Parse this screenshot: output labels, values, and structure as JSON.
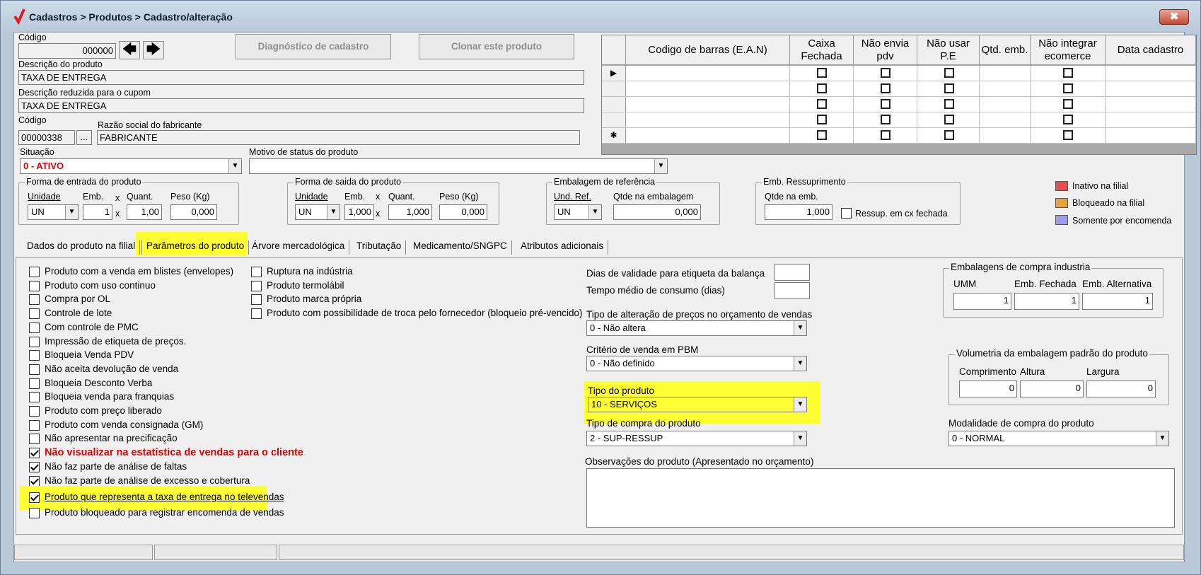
{
  "window": {
    "title": "Cadastros > Produtos > Cadastro/alteração",
    "close_label": "✖"
  },
  "header": {
    "codigo_label": "Código",
    "codigo_value": "000000",
    "diag_btn": "Diagnóstico de cadastro",
    "clonar_btn": "Clonar este produto",
    "descricao_label": "Descrição  do produto",
    "descricao_value": "TAXA DE ENTREGA",
    "desc_red_label": "Descrição reduzida para o cupom",
    "desc_red_value": "TAXA DE ENTREGA",
    "fab_codigo_label": "Código",
    "fab_codigo_value": "00000338",
    "fab_btn": "...",
    "razao_label": "Razão social do fabricante",
    "razao_value": "FABRICANTE",
    "situacao_label": "Situação",
    "situacao_value": "0 - ATIVO",
    "motivo_label": "Motivo de status do produto",
    "motivo_value": ""
  },
  "barcode_grid": {
    "columns": [
      "Codigo de barras (E.A.N)",
      "Caixa Fechada",
      "Não envia pdv",
      "Não usar P.E",
      "Qtd. emb.",
      "Não integrar ecomerce",
      "Data cadastro"
    ],
    "rows": [
      {
        "indicator": "▶"
      },
      {
        "indicator": ""
      },
      {
        "indicator": ""
      },
      {
        "indicator": ""
      },
      {
        "indicator": "✱"
      }
    ]
  },
  "entrada": {
    "title": "Forma de entrada do produto",
    "unidade_label": "Unidade",
    "emb_label": "Emb.",
    "quant_label": "Quant.",
    "peso_label": "Peso (Kg)",
    "unidade": "UN",
    "emb": "1",
    "quant": "1,00",
    "peso": "0,000",
    "x": "x"
  },
  "saida": {
    "title": "Forma de saida do produto",
    "unidade_label": "Unidade",
    "emb_label": "Emb.",
    "quant_label": "Quant.",
    "peso_label": "Peso (Kg)",
    "unidade": "UN",
    "emb": "1,000",
    "quant": "1,000",
    "peso": "0,000",
    "x": "x"
  },
  "embref": {
    "title": "Embalagem de referência",
    "und_label": "Und. Ref.",
    "qtde_label": "Qtde na embalagem",
    "und": "UN",
    "qtde": "0,000"
  },
  "ressup": {
    "title": "Emb. Ressuprimento",
    "qtde_label": "Qtde na emb.",
    "qtde": "1,000",
    "cx_label": "Ressup. em cx fechada"
  },
  "legend": [
    {
      "label": "Inativo na filial",
      "color": "#e05050"
    },
    {
      "label": "Bloqueado na filial",
      "color": "#e8a040"
    },
    {
      "label": "Somente por encomenda",
      "color": "#9c9ce8"
    }
  ],
  "tabs": [
    "Dados do produto na filial",
    "Parâmetros do produto",
    "Árvore mercadológica",
    "Tributação",
    "Medicamento/SNGPC",
    "Atributos adicionais"
  ],
  "checks_left": [
    {
      "label": "Produto com a venda em blistes (envelopes)",
      "on": false
    },
    {
      "label": "Produto com uso continuo",
      "on": false
    },
    {
      "label": "Compra por OL",
      "on": false
    },
    {
      "label": "Controle de lote",
      "on": false
    },
    {
      "label": "Com controle de PMC",
      "on": false
    },
    {
      "label": "Impressão de etiqueta de preços.",
      "on": false
    },
    {
      "label": "Bloqueia Venda PDV",
      "on": false
    },
    {
      "label": "Não aceita devolução de venda",
      "on": false
    },
    {
      "label": "Bloqueia Desconto Verba",
      "on": false
    },
    {
      "label": "Bloqueia venda para franquias",
      "on": false
    },
    {
      "label": "Produto com preço liberado",
      "on": false
    },
    {
      "label": "Produto com venda consignada (GM)",
      "on": false
    },
    {
      "label": "Não apresentar na precificação",
      "on": false
    },
    {
      "label": "Não visualizar na estatística de vendas para o cliente",
      "on": true
    },
    {
      "label": "Não faz parte de análise de faltas",
      "on": true
    },
    {
      "label": "Não faz parte de análise de excesso e cobertura",
      "on": true
    }
  ],
  "checks_bottom": [
    {
      "label": "Produto que representa a taxa de entrega no televendas",
      "on": true
    },
    {
      "label": "Produto bloqueado para registrar encomenda de vendas",
      "on": false
    }
  ],
  "checks_mid": [
    {
      "label": "Ruptura na indústria",
      "on": false
    },
    {
      "label": "Produto termolábil",
      "on": false
    },
    {
      "label": "Produto marca própria",
      "on": false
    },
    {
      "label": "Produto com possibilidade de troca pelo fornecedor (bloqueio pré-vencido)",
      "on": false
    }
  ],
  "params": {
    "dias_label": "Dias de validade para etiqueta da balança",
    "dias_value": "",
    "tempo_label": "Tempo médio de consumo (dias)",
    "tempo_value": "",
    "tipo_alt_label": "Tipo de alteração de preços no orçamento de vendas",
    "tipo_alt_value": "0 - Não altera",
    "criterio_label": "Critério de venda em PBM",
    "criterio_value": "0 - Não definido",
    "tipo_prod_label": "Tipo do produto",
    "tipo_prod_value": "10 - SERVIÇOS",
    "tipo_compra_label": "Tipo de compra do produto",
    "tipo_compra_value": "2 - SUP-RESSUP",
    "obs_label": "Observações do produto (Apresentado no orçamento)",
    "obs_value": ""
  },
  "embalagens": {
    "title": "Embalagens de compra industria",
    "umm_label": "UMM",
    "fechada_label": "Emb. Fechada",
    "alt_label": "Emb. Alternativa",
    "umm": "1",
    "fechada": "1",
    "alt": "1"
  },
  "volumetria": {
    "title": "Volumetria da embalagem padrão do produto",
    "comp_label": "Comprimento",
    "alt_label": "Altura",
    "larg_label": "Largura",
    "comp": "0",
    "alt": "0",
    "larg": "0"
  },
  "modalidade": {
    "label": "Modalidade de compra do produto",
    "value": "0 - NORMAL"
  }
}
